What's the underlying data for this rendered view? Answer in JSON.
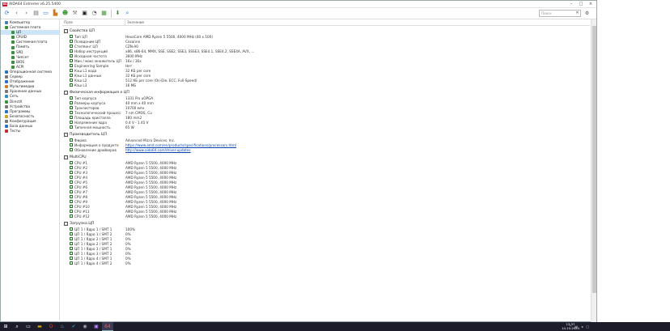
{
  "window": {
    "logo": "64",
    "title": "AIDA64 Extreme v6.25.5400"
  },
  "toolbar": {
    "search_placeholder": "Поиск"
  },
  "sidebar": {
    "items": [
      {
        "label": "Компьютер",
        "level": 0,
        "arrow": "›",
        "color": "#4a7bb5"
      },
      {
        "label": "Системная плата",
        "level": 0,
        "arrow": "⌄",
        "color": "#3a8f3a"
      },
      {
        "label": "ЦП",
        "level": 1,
        "arrow": "",
        "color": "#3a8f3a",
        "selected": true
      },
      {
        "label": "CPUID",
        "level": 1,
        "arrow": "",
        "color": "#3a8f3a"
      },
      {
        "label": "Системная плата",
        "level": 1,
        "arrow": "",
        "color": "#3a8f3a"
      },
      {
        "label": "Память",
        "level": 1,
        "arrow": "",
        "color": "#3a8f3a"
      },
      {
        "label": "SPD",
        "level": 1,
        "arrow": "",
        "color": "#3a8f3a"
      },
      {
        "label": "Чипсет",
        "level": 1,
        "arrow": "",
        "color": "#3a8f3a"
      },
      {
        "label": "BIOS",
        "level": 1,
        "arrow": "",
        "color": "#3a8f3a"
      },
      {
        "label": "ACPI",
        "level": 1,
        "arrow": "",
        "color": "#3a8f3a"
      },
      {
        "label": "Операционная система",
        "level": 0,
        "arrow": "›",
        "color": "#2a6fc9"
      },
      {
        "label": "Сервер",
        "level": 0,
        "arrow": "›",
        "color": "#777"
      },
      {
        "label": "Отображение",
        "level": 0,
        "arrow": "›",
        "color": "#2a6fc9"
      },
      {
        "label": "Мультимедиа",
        "level": 0,
        "arrow": "›",
        "color": "#c97a2a"
      },
      {
        "label": "Хранение данных",
        "level": 0,
        "arrow": "›",
        "color": "#777"
      },
      {
        "label": "Сеть",
        "level": 0,
        "arrow": "›",
        "color": "#2a8fc9"
      },
      {
        "label": "DirectX",
        "level": 0,
        "arrow": "›",
        "color": "#3a8f3a"
      },
      {
        "label": "Устройства",
        "level": 0,
        "arrow": "›",
        "color": "#777"
      },
      {
        "label": "Программы",
        "level": 0,
        "arrow": "›",
        "color": "#2a6fc9"
      },
      {
        "label": "Безопасность",
        "level": 0,
        "arrow": "›",
        "color": "#c9a02a"
      },
      {
        "label": "Конфигурация",
        "level": 0,
        "arrow": "›",
        "color": "#777"
      },
      {
        "label": "База данных",
        "level": 0,
        "arrow": "›",
        "color": "#2a6fc9"
      },
      {
        "label": "Тесты",
        "level": 0,
        "arrow": "›",
        "color": "#c92a2a"
      }
    ]
  },
  "columns": {
    "field": "Поле",
    "value": "Значение"
  },
  "sections": [
    {
      "title": "Свойства ЦП",
      "rows": [
        {
          "k": "Тип ЦП",
          "v": "HexaCore AMD Ryzen 5 5500, 4000 MHz (40 x 100)"
        },
        {
          "k": "Псевдоним ЦП",
          "v": "Cezanne"
        },
        {
          "k": "Степпинг ЦП",
          "v": "CZN-A0"
        },
        {
          "k": "Набор инструкций",
          "v": "x86, x86-64, MMX, SSE, SSE2, SSE3, SSSE3, SSE4.1, SSE4.2, SSE4A, AVX, ..."
        },
        {
          "k": "Исходная частота",
          "v": "3600 MHz"
        },
        {
          "k": "Мин / макс множитель ЦП",
          "v": "16x / 36x"
        },
        {
          "k": "Engineering Sample",
          "v": "Нет"
        },
        {
          "k": "Кэш L1 кода",
          "v": "32 КБ per core"
        },
        {
          "k": "Кэш L1 данных",
          "v": "32 КБ per core"
        },
        {
          "k": "Кэш L2",
          "v": "512 КБ per core (On-Die, ECC, Full-Speed)"
        },
        {
          "k": "Кэш L3",
          "v": "16 МБ"
        }
      ]
    },
    {
      "title": "Физическая информация о ЦП",
      "rows": [
        {
          "k": "Тип корпуса",
          "v": "1331 Pin uOPGA"
        },
        {
          "k": "Размеры корпуса",
          "v": "40 mm x 40 mm"
        },
        {
          "k": "Транзисторов",
          "v": "10700 млн"
        },
        {
          "k": "Технологический процесс",
          "v": "7 nm CMOS, Cu"
        },
        {
          "k": "Площадь кристалла",
          "v": "180 mm2"
        },
        {
          "k": "Напряжение ядра",
          "v": "0.4 V - 1.45 V"
        },
        {
          "k": "Типичная мощность",
          "v": "65 W"
        }
      ]
    },
    {
      "title": "Производитель ЦП",
      "rows": [
        {
          "k": "Фирма",
          "v": "Advanced Micro Devices, Inc."
        },
        {
          "k": "Информация о продукте",
          "v": "https://www.amd.com/en/products/specifications/processors.html",
          "link": true
        },
        {
          "k": "Обновление драйверов",
          "v": "http://www.aida64.com/driver-updates",
          "link": true
        }
      ]
    },
    {
      "title": "MultiCPU",
      "rows": [
        {
          "k": "CPU #1",
          "v": "AMD Ryzen 5 5500, 4000 MHz"
        },
        {
          "k": "CPU #2",
          "v": "AMD Ryzen 5 5500, 4000 MHz"
        },
        {
          "k": "CPU #3",
          "v": "AMD Ryzen 5 5500, 4000 MHz"
        },
        {
          "k": "CPU #4",
          "v": "AMD Ryzen 5 5500, 4000 MHz"
        },
        {
          "k": "CPU #5",
          "v": "AMD Ryzen 5 5500, 4000 MHz"
        },
        {
          "k": "CPU #6",
          "v": "AMD Ryzen 5 5500, 4000 MHz"
        },
        {
          "k": "CPU #7",
          "v": "AMD Ryzen 5 5500, 4000 MHz"
        },
        {
          "k": "CPU #8",
          "v": "AMD Ryzen 5 5500, 4000 MHz"
        },
        {
          "k": "CPU #9",
          "v": "AMD Ryzen 5 5500, 4000 MHz"
        },
        {
          "k": "CPU #10",
          "v": "AMD Ryzen 5 5500, 4000 MHz"
        },
        {
          "k": "CPU #11",
          "v": "AMD Ryzen 5 5500, 4000 MHz"
        },
        {
          "k": "CPU #12",
          "v": "AMD Ryzen 5 5500, 4000 MHz"
        }
      ]
    },
    {
      "title": "Загрузка ЦП",
      "rows": [
        {
          "k": "ЦП 1 / Ядро 1 / SMT 1",
          "v": "100%"
        },
        {
          "k": "ЦП 1 / Ядро 1 / SMT 2",
          "v": "0%"
        },
        {
          "k": "ЦП 1 / Ядро 2 / SMT 1",
          "v": "0%"
        },
        {
          "k": "ЦП 1 / Ядро 2 / SMT 2",
          "v": "0%"
        },
        {
          "k": "ЦП 1 / Ядро 3 / SMT 1",
          "v": "0%"
        },
        {
          "k": "ЦП 1 / Ядро 3 / SMT 2",
          "v": "0%"
        },
        {
          "k": "ЦП 1 / Ядро 4 / SMT 1",
          "v": "0%"
        },
        {
          "k": "ЦП 1 / Ядро 4 / SMT 2",
          "v": "0%"
        }
      ]
    }
  ],
  "taskbar": {
    "time": "13:37",
    "date": "14.10.2024"
  }
}
